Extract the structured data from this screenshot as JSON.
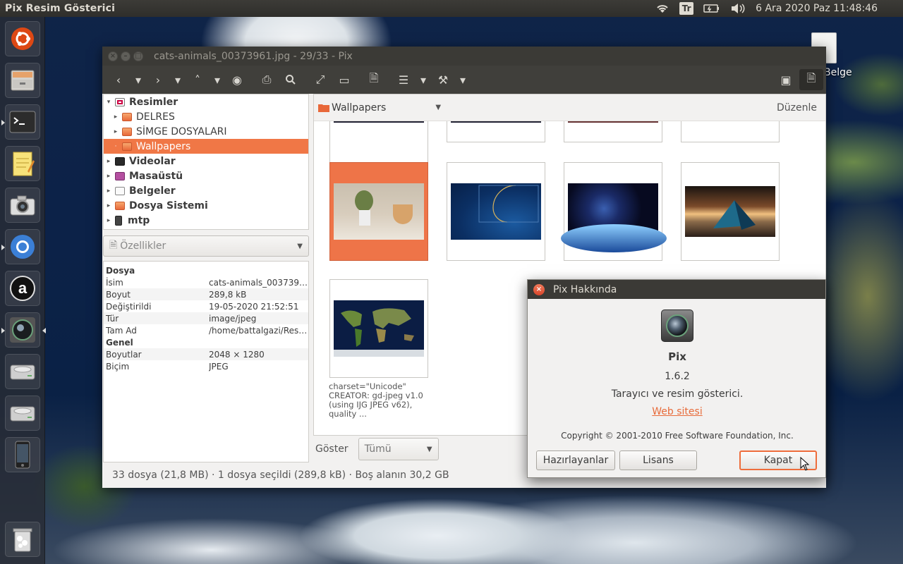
{
  "panel": {
    "app_title": "Pix Resim Gösterici",
    "keyboard": "Tr",
    "clock": "6 Ara 2020 Paz 11:48:46"
  },
  "desktop": {
    "icon_label": "Belge"
  },
  "window": {
    "title": "cats-animals_00373961.jpg - 29/33 - Pix"
  },
  "sidebar": {
    "tree": [
      {
        "label": "Resimler",
        "icon": "pictures-icon",
        "bold": true
      },
      {
        "label": "DELRES",
        "icon": "folder-icon",
        "bold": false
      },
      {
        "label": "SİMGE DOSYALARI",
        "icon": "folder-icon",
        "bold": false
      },
      {
        "label": "Wallpapers",
        "icon": "folder-icon",
        "bold": false,
        "selected": true
      },
      {
        "label": "Videolar",
        "icon": "video-icon",
        "bold": true
      },
      {
        "label": "Masaüstü",
        "icon": "desktop-icon",
        "bold": true
      },
      {
        "label": "Belgeler",
        "icon": "documents-icon",
        "bold": true
      },
      {
        "label": "Dosya Sistemi",
        "icon": "filesystem-icon",
        "bold": true
      },
      {
        "label": "mtp",
        "icon": "device-icon",
        "bold": true
      }
    ],
    "properties_label": "Özellikler",
    "properties": [
      {
        "key": "Dosya",
        "value": "",
        "section": true
      },
      {
        "key": "İsim",
        "value": "cats-animals_00373961..."
      },
      {
        "key": "Boyut",
        "value": "289,8 kB"
      },
      {
        "key": "Değiştirildi",
        "value": "19-05-2020 21:52:51"
      },
      {
        "key": "Tür",
        "value": "image/jpeg"
      },
      {
        "key": "Tam Ad",
        "value": "/home/battalgazi/Resi..."
      },
      {
        "key": "Genel",
        "value": "",
        "section": true
      },
      {
        "key": "Boyutlar",
        "value": "2048 × 1280"
      },
      {
        "key": "Biçim",
        "value": "JPEG"
      }
    ]
  },
  "browser": {
    "location": "Wallpapers",
    "edit_label": "Düzenle",
    "caption": "charset=\"Unicode\"\nCREATOR: gd-jpeg v1.0\n(using IJG JPEG v62),\nquality ...",
    "filter_label": "Göster",
    "filter_value": "Tümü"
  },
  "status": {
    "text": "33 dosya (21,8 MB) · 1 dosya seçildi (289,8 kB) · Boş alanın 30,2 GB"
  },
  "about_dialog": {
    "title": "Pix Hakkında",
    "app_name": "Pix",
    "version": "1.6.2",
    "description": "Tarayıcı ve resim gösterici.",
    "website": "Web sitesi",
    "copyright": "Copyright © 2001-2010 Free Software Foundation, Inc.",
    "credits_button": "Hazırlayanlar",
    "license_button": "Lisans",
    "close_button": "Kapat"
  },
  "colors": {
    "accent": "#f07746",
    "panel": "#3c3b37"
  }
}
